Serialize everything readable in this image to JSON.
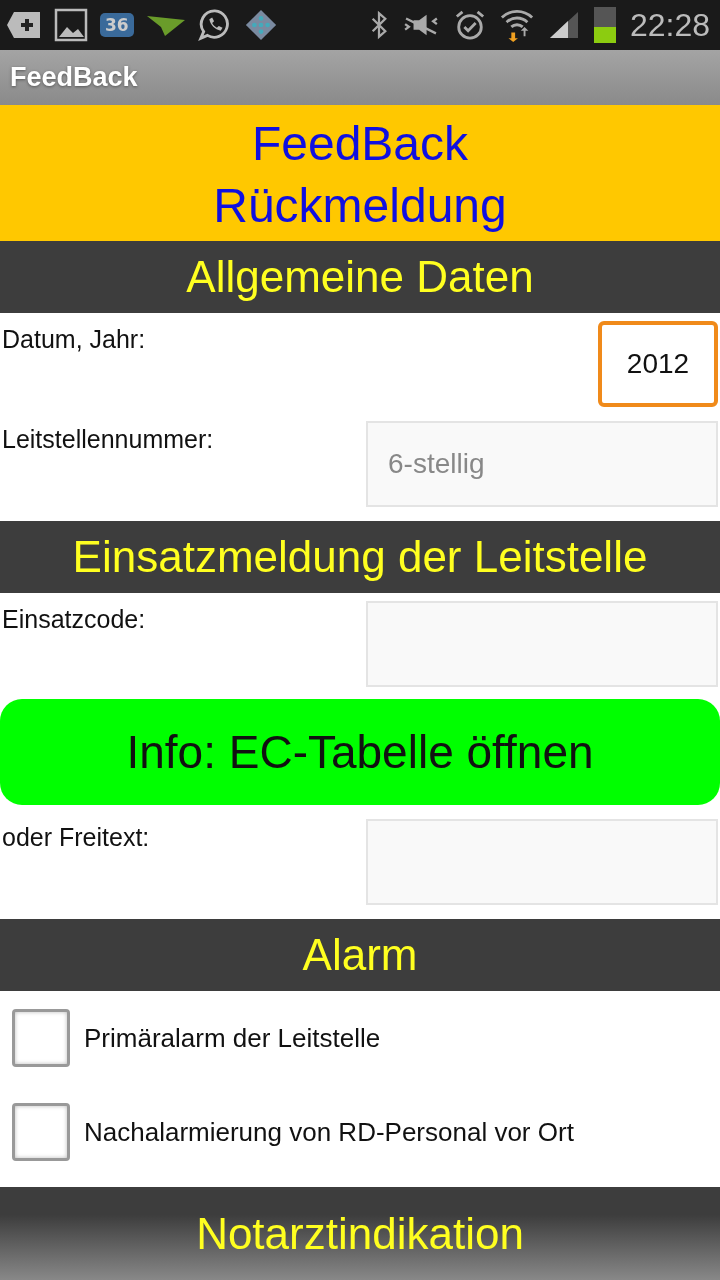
{
  "status_bar": {
    "badge_count": "36",
    "time": "22:28"
  },
  "app_bar": {
    "title": "FeedBack"
  },
  "header": {
    "lines": [
      "FeedBack",
      "Rückmeldung"
    ]
  },
  "sections": [
    {
      "kind": "form",
      "title": "Allgemeine Daten",
      "items": [
        {
          "kind": "year_field",
          "label": "Datum, Jahr:",
          "value": "2012",
          "focused": true
        },
        {
          "kind": "field",
          "label": "Leitstellennummer:",
          "placeholder": "6-stellig",
          "focused": false
        }
      ]
    },
    {
      "kind": "form",
      "title": "Einsatzmeldung der Leitstelle",
      "items": [
        {
          "kind": "field",
          "label": "Einsatzcode:",
          "focused": false
        },
        {
          "kind": "button",
          "label": "Info: EC-Tabelle öffnen"
        },
        {
          "kind": "field",
          "label": "oder Freitext:",
          "focused": false
        }
      ]
    },
    {
      "kind": "form",
      "title": "Alarm",
      "items": [
        {
          "kind": "checkbox",
          "label": "Primäralarm der Leitstelle",
          "checked": false
        },
        {
          "kind": "checkbox",
          "label": "Nachalarmierung von RD-Personal vor Ort",
          "checked": false
        }
      ]
    },
    {
      "kind": "form",
      "title": "Notarztindikation"
    }
  ]
}
